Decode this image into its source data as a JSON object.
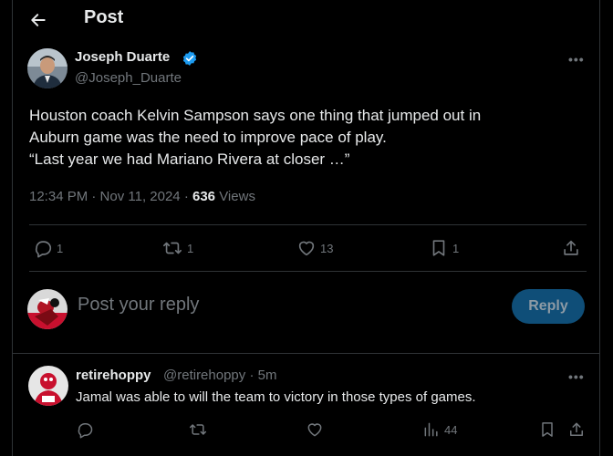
{
  "header": {
    "title": "Post"
  },
  "post": {
    "author_name": "Joseph Duarte",
    "author_handle": "@Joseph_Duarte",
    "text_lines": [
      "Houston coach Kelvin Sampson says one thing that jumped out in",
      "Auburn game was the need to improve pace of play.",
      "“Last year we had Mariano Rivera at closer …”"
    ],
    "timestamp": "12:34 PM · Nov 11, 2024 ·",
    "views_count": "636",
    "views_label": "Views",
    "stats": {
      "replies": "1",
      "reposts": "1",
      "likes": "13",
      "bookmarks": "1"
    }
  },
  "reply_box": {
    "placeholder": "Post your reply",
    "button": "Reply"
  },
  "comment": {
    "author_name": "retirehoppy",
    "handle_time": "@retirehoppy · 5m",
    "text": "Jamal was able to will the team to victory in those types of games.",
    "views": "44"
  },
  "colors": {
    "accent": "#1d9bf0",
    "muted": "#71767b",
    "border": "#2f3336",
    "reply_button_bg": "#0f4e78"
  }
}
